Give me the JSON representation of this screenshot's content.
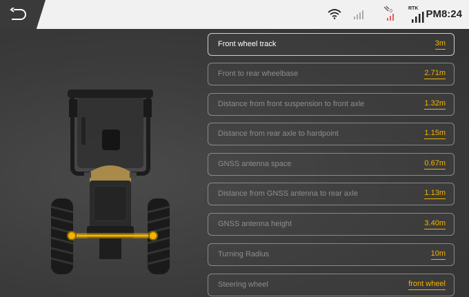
{
  "status_bar": {
    "rtk_label": "RTK",
    "time": "PM8:24"
  },
  "settings": [
    {
      "label": "Front wheel track",
      "value": "3m"
    },
    {
      "label": "Front to rear wheelbase",
      "value": "2.71m"
    },
    {
      "label": "Distance from front suspension to front axle",
      "value": "1.32m"
    },
    {
      "label": "Distance from rear axle to hardpoint",
      "value": "1.15m"
    },
    {
      "label": "GNSS antenna space",
      "value": "0.67m"
    },
    {
      "label": "Distance from GNSS antenna to rear axle",
      "value": "1.13m"
    },
    {
      "label": "GNSS antenna height",
      "value": "3.40m"
    },
    {
      "label": "Turning Radius",
      "value": "10m"
    },
    {
      "label": "Steering wheel",
      "value": "front wheel"
    }
  ],
  "colors": {
    "accent": "#f4b400",
    "background": "#3a3a3a",
    "topbar": "#f1f1f1"
  }
}
